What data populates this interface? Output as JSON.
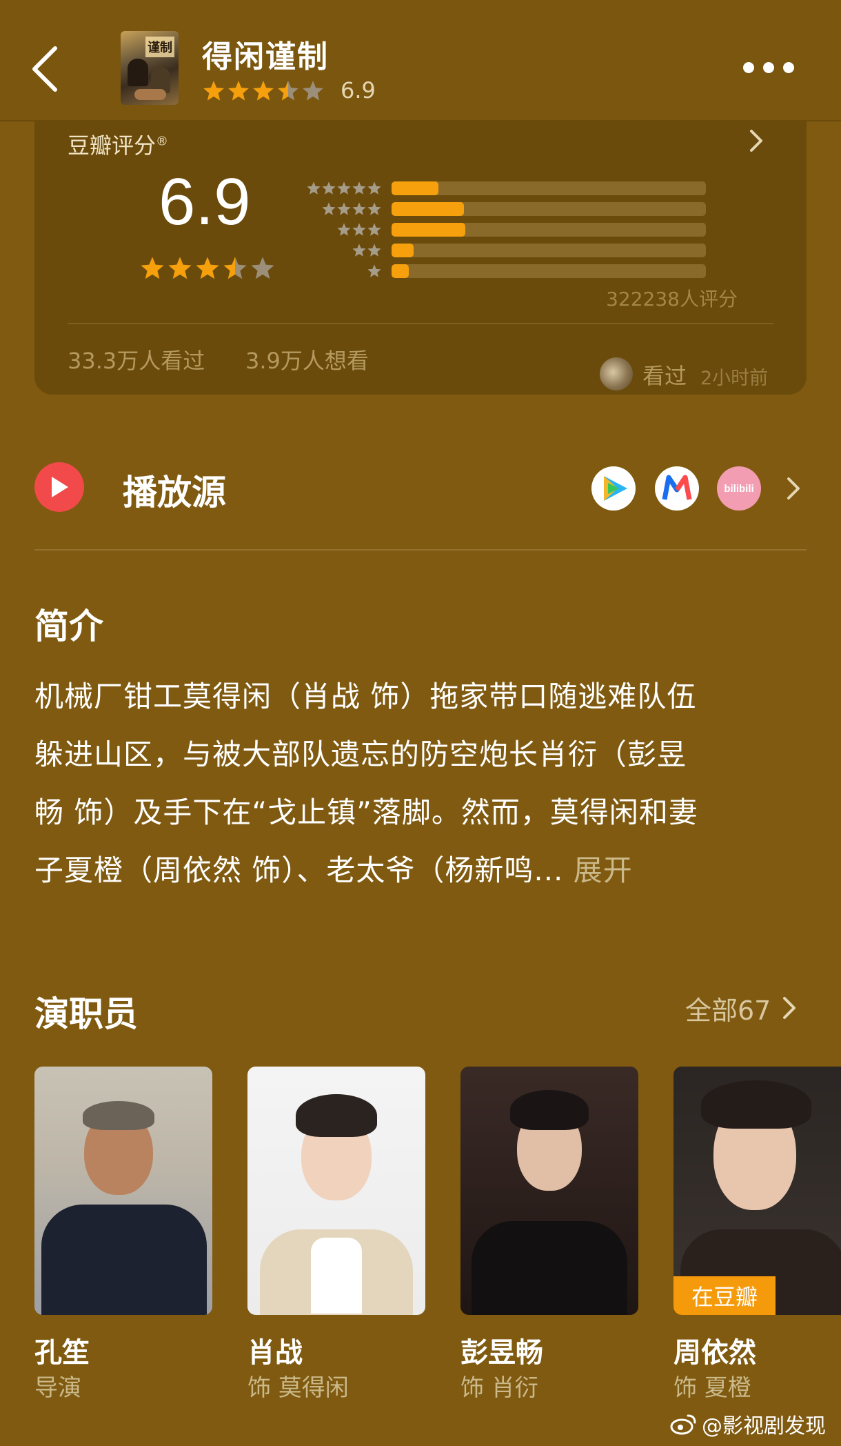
{
  "header": {
    "title": "得闲谨制",
    "score": "6.9",
    "poster_text": "谨制"
  },
  "rating_card": {
    "label": "豆瓣评分",
    "registered_mark": "®",
    "score": "6.9",
    "star_value": 3.5,
    "distribution": [
      {
        "stars": 5,
        "fraction": 0.15
      },
      {
        "stars": 4,
        "fraction": 0.23
      },
      {
        "stars": 3,
        "fraction": 0.235
      },
      {
        "stars": 2,
        "fraction": 0.07
      },
      {
        "stars": 1,
        "fraction": 0.055
      }
    ],
    "rating_count": "322238人评分",
    "watched": "33.3万人看过",
    "wish": "3.9万人想看",
    "recent_label": "看过",
    "recent_time": "2小时前"
  },
  "play_sources": {
    "label": "播放源",
    "sources": [
      "tencent-video",
      "mango-tv",
      "bilibili"
    ],
    "bilibili_text": "bilibili"
  },
  "intro": {
    "title": "简介",
    "lines": [
      "机械厂钳工莫得闲（肖战 饰）拖家带口随逃难队伍",
      "躲进山区，与被大部队遗忘的防空炮长肖衍（彭昱",
      "畅 饰）及手下在“戈止镇”落脚。然而，莫得闲和妻",
      "子夏橙（周依然 饰）、老太爷（杨新鸣..."
    ],
    "expand": "展开"
  },
  "cast": {
    "title": "演职员",
    "all_label": "全部67",
    "members": [
      {
        "name": "孔笙",
        "role": "导演"
      },
      {
        "name": "肖战",
        "role": "饰 莫得闲"
      },
      {
        "name": "彭昱畅",
        "role": "饰 肖衍"
      },
      {
        "name": "周依然",
        "role": "饰 夏橙",
        "badge": "在豆瓣"
      }
    ]
  },
  "watermark": "@影视剧发现",
  "colors": {
    "background": "#7f5a10",
    "star": "#f5a00c",
    "star_empty": "#9b8f7a",
    "accent_red": "#f24a4a"
  }
}
